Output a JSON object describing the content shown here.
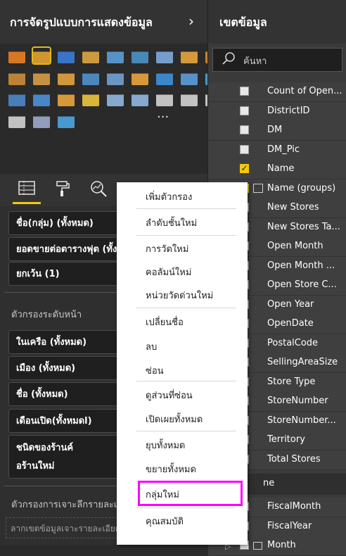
{
  "viz_pane": {
    "title": "การจัดรูปแบบการแสดงข้อมูล",
    "chevron": "›",
    "more_icon_label": "···",
    "viz_icons": [
      {
        "name": "stacked-bar-icon",
        "color": "#e67e22"
      },
      {
        "name": "stacked-column-icon",
        "color": "#e0a030"
      },
      {
        "name": "clustered-bar-icon",
        "color": "#3a7bd5"
      },
      {
        "name": "clustered-column-icon",
        "color": "#d9a441"
      },
      {
        "name": "100-stacked-bar-icon",
        "color": "#5b9bd5"
      },
      {
        "name": "100-stacked-column-icon",
        "color": "#4a90c2"
      },
      {
        "name": "line-chart-icon",
        "color": "#7aa9d9"
      },
      {
        "name": "area-chart-icon",
        "color": "#e3a33a"
      },
      {
        "name": "stacked-area-icon",
        "color": "#e08a2d"
      },
      {
        "name": "line-clustered-column-icon",
        "color": "#c98a3a"
      },
      {
        "name": "line-stacked-column-icon",
        "color": "#d49a45"
      },
      {
        "name": "ribbon-chart-icon",
        "color": "#e09f3e"
      },
      {
        "name": "waterfall-chart-icon",
        "color": "#4f8fc9"
      },
      {
        "name": "scatter-chart-icon",
        "color": "#6f9fd0"
      },
      {
        "name": "pie-chart-icon",
        "color": "#e6a23c"
      },
      {
        "name": "donut-chart-icon",
        "color": "#3c8fd6"
      },
      {
        "name": "treemap-icon",
        "color": "#5b9bd5"
      },
      {
        "name": "map-icon",
        "color": "#4aa3df"
      },
      {
        "name": "filled-map-icon",
        "color": "#4a86c5"
      },
      {
        "name": "shape-map-icon",
        "color": "#4a8fd5"
      },
      {
        "name": "funnel-icon",
        "color": "#e6a23c"
      },
      {
        "name": "gauge-icon",
        "color": "#e6c23c"
      },
      {
        "name": "card-icon",
        "color": "#8fb4dd"
      },
      {
        "name": "multi-row-card-icon",
        "color": "#8fb4dd"
      },
      {
        "name": "kpi-icon",
        "color": "#cfcfcf"
      },
      {
        "name": "slicer-icon",
        "color": "#cfcfcf"
      },
      {
        "name": "table-icon",
        "color": "#cfcfcf"
      },
      {
        "name": "matrix-icon",
        "color": "#cfcfcf"
      },
      {
        "name": "r-visual-icon",
        "color": "#9aa7c7"
      },
      {
        "name": "globe-icon",
        "color": "#4aa3df"
      }
    ],
    "tool_tabs": [
      {
        "name": "fields-tab-icon",
        "glyph": "▤"
      },
      {
        "name": "format-paint-roller-icon",
        "glyph": "🖌"
      },
      {
        "name": "analytics-magnifier-icon",
        "glyph": "⌕"
      }
    ],
    "visual_filters": [
      "ชื่อ(กลุ่ม) (ทั้งหมด)",
      "ยอดขายต่อตารางฟุต (ทั้งหมด)",
      "ยกเว้น (1)"
    ],
    "page_filters_label": "ตัวกรองระดับหน้า",
    "page_filters": [
      "ในเครือ (ทั้งหมด)",
      "เมือง (ทั้งหมด)",
      "ชื่อ (ทั้งหมด)",
      "เดือนเปิด(ทั้งหมดl)"
    ],
    "store_type_filter_line1": "ชนิดของร้านค์",
    "store_type_filter_line2": "อร้านใหม่",
    "drillthrough_label": "ตัวกรองการเจาะลึกรายละเอียด",
    "drillthrough_drop": "ลากเขตข้อมูลเจาะรายละเอียดที่นี่"
  },
  "fields_pane": {
    "title": "เขตข้อมูล",
    "search_placeholder": "ค้นหา",
    "fields": [
      {
        "label": "Count of Open...",
        "checked": false
      },
      {
        "label": "DistrictID",
        "checked": false
      },
      {
        "label": "DM",
        "checked": false
      },
      {
        "label": "DM_Pic",
        "checked": false
      },
      {
        "label": "Name",
        "checked": true
      },
      {
        "label": "Name (groups)",
        "checked": true
      },
      {
        "label": "New Stores",
        "checked": false
      },
      {
        "label": "New Stores Ta...",
        "checked": false
      },
      {
        "label": "Open Month",
        "checked": false
      },
      {
        "label": "Open Month ...",
        "checked": false
      },
      {
        "label": "Open Store C...",
        "checked": false
      },
      {
        "label": "Open Year",
        "checked": false
      },
      {
        "label": "OpenDate",
        "checked": false
      },
      {
        "label": "PostalCode",
        "checked": false
      },
      {
        "label": "SellingAreaSize",
        "checked": false
      },
      {
        "label": "Store Type",
        "checked": false
      },
      {
        "label": "StoreNumber",
        "checked": false
      },
      {
        "label": "StoreNumber...",
        "checked": false
      },
      {
        "label": "Territory",
        "checked": false
      },
      {
        "label": "Total Stores",
        "checked": false
      }
    ],
    "table_header": "ne",
    "time_fields": [
      {
        "label": "FiscalMonth",
        "checked": false
      },
      {
        "label": "FiscalYear",
        "checked": false
      },
      {
        "label": "Month",
        "checked": false
      }
    ]
  },
  "context_menu": {
    "items": [
      "เพิ่มตัวกรอง",
      "ลำดับชั้นใหม่",
      "การวัดใหม่",
      "คอลัมน์ใหม่",
      "หน่วยวัดด่วนใหม่",
      "เปลี่ยนชื่อ",
      "ลบ",
      "ซ่อน",
      "ดูส่วนที่ซ่อน",
      "เปิดเผยทั้งหมด",
      "ยุบทั้งหมด",
      "ขยายทั้งหมด",
      "กลุ่มใหม่",
      "คุณสมบัติ"
    ],
    "highlighted_item": "กลุ่มใหม่",
    "highlight_color": "#ff00ff"
  }
}
